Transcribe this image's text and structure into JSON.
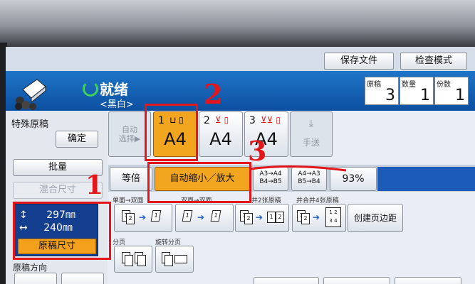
{
  "header": {
    "saved_files": "保存文件",
    "check_mode": "检查模式",
    "status": "就绪",
    "mode": "<黑白>"
  },
  "counters": [
    {
      "label": "原稿",
      "value": "3"
    },
    {
      "label": "数量",
      "value": "1"
    },
    {
      "label": "份数",
      "value": "1"
    }
  ],
  "left": {
    "special_original": "特殊原稿",
    "confirm": "确定",
    "batch": "批量",
    "mixed_size": "混合尺寸",
    "size_height": "297㎜",
    "size_width": "240㎜",
    "original_size": "原稿尺寸",
    "original_direction": "原稿方向"
  },
  "paper": {
    "auto": "自动\n选择▶",
    "trays": [
      {
        "num": "1",
        "size": "A4"
      },
      {
        "num": "2",
        "size": "A4"
      },
      {
        "num": "3",
        "size": "A4"
      }
    ],
    "bypass": "手送"
  },
  "zoom": {
    "same": "等倍",
    "auto_zoom": "自动缩小／放大",
    "preset1_line1": "A3→A4",
    "preset1_line2": "B4→B5",
    "preset2_line1": "A4→A3",
    "preset2_line2": "B5→B4",
    "percent": "93%"
  },
  "duplex": {
    "label_single_double": "单面→双面",
    "label_double_double": "双面→双面",
    "label_merge2": "并2张原稿",
    "label_merge4": "并合并4张原稿",
    "create_margin": "创建页边距"
  },
  "sort": {
    "label_sort": "分页",
    "label_rotate": "旋转分页"
  },
  "annotations": [
    "2",
    "3",
    "1"
  ],
  "colors": {
    "accent": "#f2a51f",
    "header_blue": "#0c4fa0",
    "annotation": "#e3161b"
  }
}
